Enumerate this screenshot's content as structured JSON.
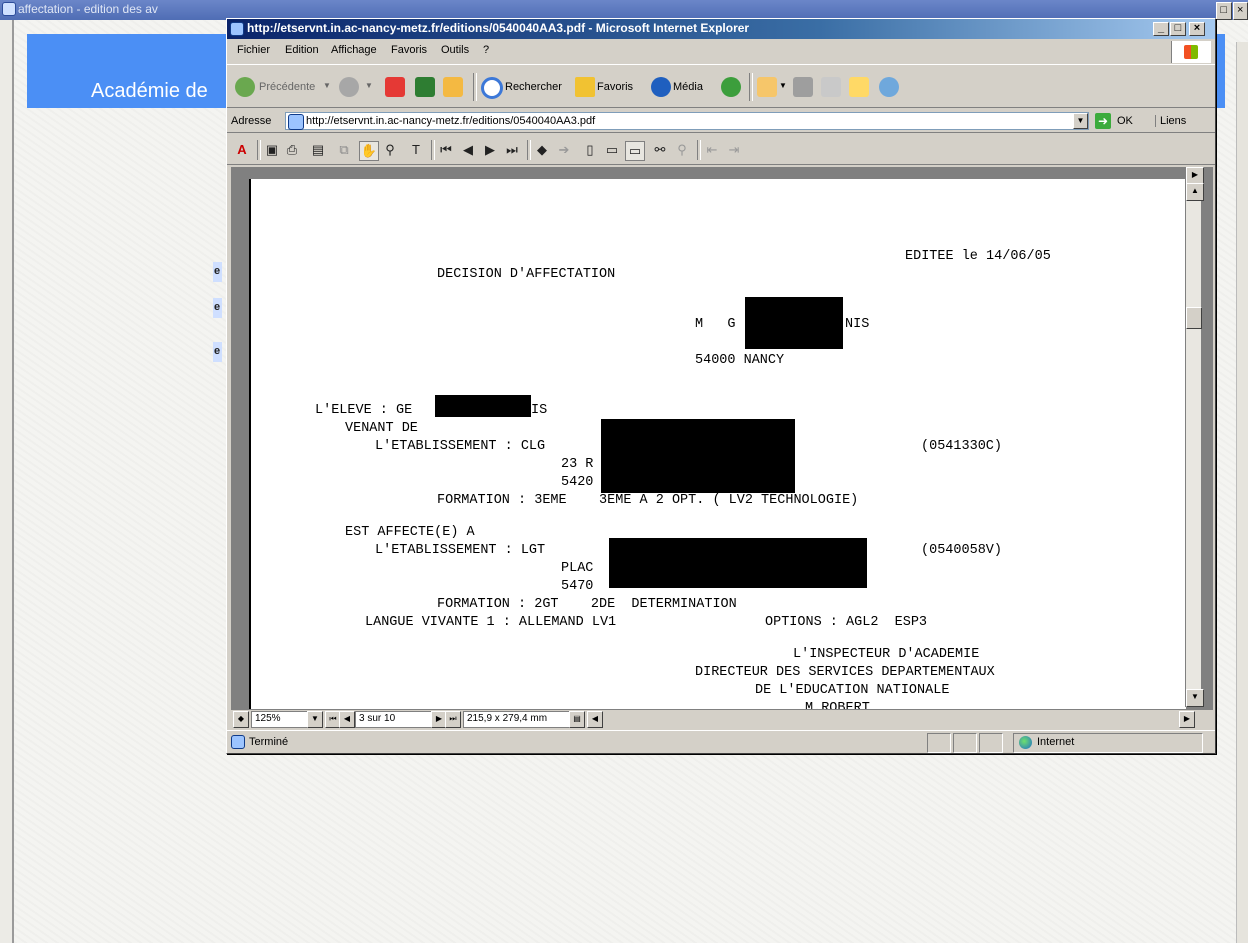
{
  "background_window": {
    "title": "affectation - edition des av",
    "banner_text": "Académie de",
    "links": [
      "e",
      "e",
      "e"
    ]
  },
  "window": {
    "title": "http://etservnt.in.ac-nancy-metz.fr/editions/0540040AA3.pdf - Microsoft Internet Explorer"
  },
  "menu": [
    "Fichier",
    "Edition",
    "Affichage",
    "Favoris",
    "Outils",
    "?"
  ],
  "toolbar": {
    "back": "Précédente",
    "search": "Rechercher",
    "favorites": "Favoris",
    "media": "Média"
  },
  "address": {
    "label": "Adresse",
    "value": "http://etservnt.in.ac-nancy-metz.fr/editions/0540040AA3.pdf",
    "go": "OK",
    "links": "Liens"
  },
  "document": {
    "edited": "EDITEE le 14/06/05",
    "title": "DECISION D'AFFECTATION",
    "recipient_prefix": "M   G",
    "recipient_suffix": "NIS",
    "recipient_city": "54000 NANCY",
    "student_label": "L'ELEVE : GE",
    "student_suffix": "IS",
    "from_label": "VENANT DE",
    "from_estab_label": "L'ETABLISSEMENT : CLG",
    "from_code": "(0541330C)",
    "from_line2": "23 R",
    "from_line3": "5420",
    "from_formation": "FORMATION : 3EME    3EME A 2 OPT. ( LV2 TECHNOLOGIE)",
    "to_label": "EST AFFECTE(E) A",
    "to_estab_label": "L'ETABLISSEMENT : LGT",
    "to_code": "(0540058V)",
    "to_line2": "PLAC",
    "to_line3": "5470",
    "to_formation": "FORMATION : 2GT    2DE  DETERMINATION",
    "language": "LANGUE VIVANTE 1 : ALLEMAND LV1",
    "options": "OPTIONS : AGL2  ESP3",
    "sign1": "L'INSPECTEUR D'ACADEMIE",
    "sign2": "DIRECTEUR DES SERVICES DEPARTEMENTAUX",
    "sign3": "DE L'EDUCATION NATIONALE",
    "sign4": "M.ROBERT"
  },
  "pdf_status": {
    "zoom": "125%",
    "page": "3 sur 10",
    "size": "215,9 x 279,4 mm"
  },
  "status": {
    "text": "Terminé",
    "zone": "Internet"
  }
}
